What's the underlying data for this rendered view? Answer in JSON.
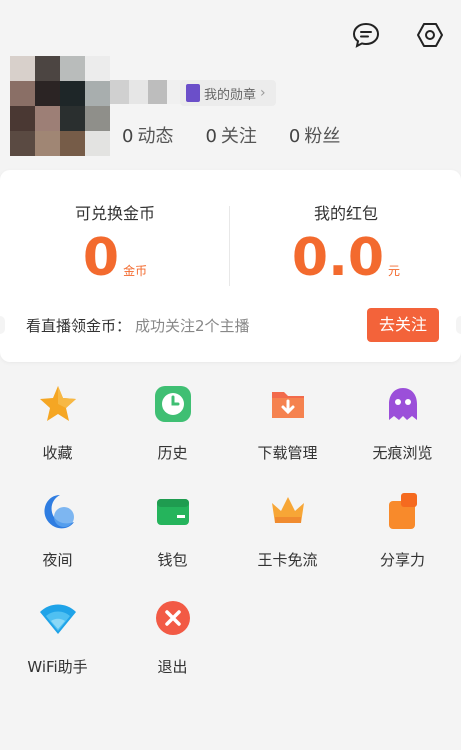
{
  "header": {
    "icons": [
      "message-icon",
      "settings-hexagon-icon"
    ]
  },
  "profile": {
    "badge_label": "我的勋章",
    "stats": [
      {
        "num": "0",
        "label": "动态"
      },
      {
        "num": "0",
        "label": "关注"
      },
      {
        "num": "0",
        "label": "粉丝"
      }
    ]
  },
  "wallet": {
    "coins_label": "可兑换金币",
    "coins_value": "0",
    "coins_unit": "金币",
    "redpack_label": "我的红包",
    "redpack_value": "0.0",
    "redpack_unit": "元",
    "live_label": "看直播领金币：",
    "live_desc": "成功关注2个主播",
    "follow_button": "去关注"
  },
  "menu": [
    {
      "label": "收藏",
      "icon": "star-icon"
    },
    {
      "label": "历史",
      "icon": "clock-icon"
    },
    {
      "label": "下载管理",
      "icon": "download-folder-icon"
    },
    {
      "label": "无痕浏览",
      "icon": "ghost-icon"
    },
    {
      "label": "夜间",
      "icon": "moon-icon"
    },
    {
      "label": "钱包",
      "icon": "wallet-icon"
    },
    {
      "label": "王卡免流",
      "icon": "crown-icon"
    },
    {
      "label": "分享力",
      "icon": "share-icon"
    },
    {
      "label": "WiFi助手",
      "icon": "wifi-icon"
    },
    {
      "label": "退出",
      "icon": "exit-icon"
    }
  ],
  "colors": {
    "accent": "#f36a2e",
    "button": "#f3633a"
  }
}
